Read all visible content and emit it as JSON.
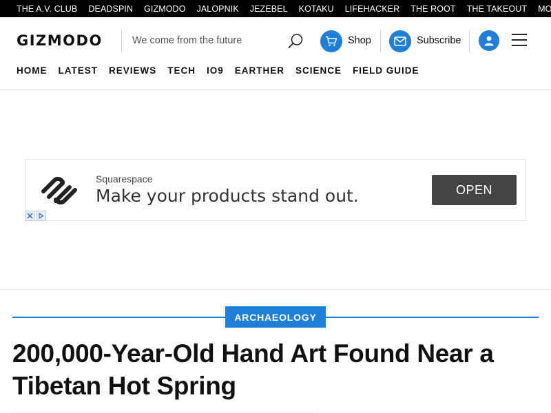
{
  "network": {
    "sites": [
      "THE A.V. CLUB",
      "DEADSPIN",
      "GIZMODO",
      "JALOPNIK",
      "JEZEBEL",
      "KOTAKU",
      "LIFEHACKER",
      "THE ROOT",
      "THE TAKEOUT"
    ],
    "more_label": "MORE"
  },
  "header": {
    "logo": "GIZMODO",
    "tagline": "We come from the future",
    "shop_label": "Shop",
    "subscribe_label": "Subscribe",
    "icons": {
      "search": "search-icon",
      "shop": "cart-icon",
      "subscribe": "mail-icon",
      "account": "user-icon",
      "menu": "hamburger-menu-icon"
    }
  },
  "nav": {
    "items": [
      "HOME",
      "LATEST",
      "REVIEWS",
      "TECH",
      "IO9",
      "EARTHER",
      "SCIENCE",
      "FIELD GUIDE"
    ]
  },
  "ad": {
    "brand": "Squarespace",
    "headline": "Make your products stand out.",
    "cta": "OPEN"
  },
  "article": {
    "category": "ARCHAEOLOGY",
    "headline": "200,000-Year-Old Hand Art Found Near a Tibetan Hot Spring"
  },
  "colors": {
    "accent": "#1d7fd8",
    "network_bar": "#000000",
    "ad_button": "#444444"
  }
}
